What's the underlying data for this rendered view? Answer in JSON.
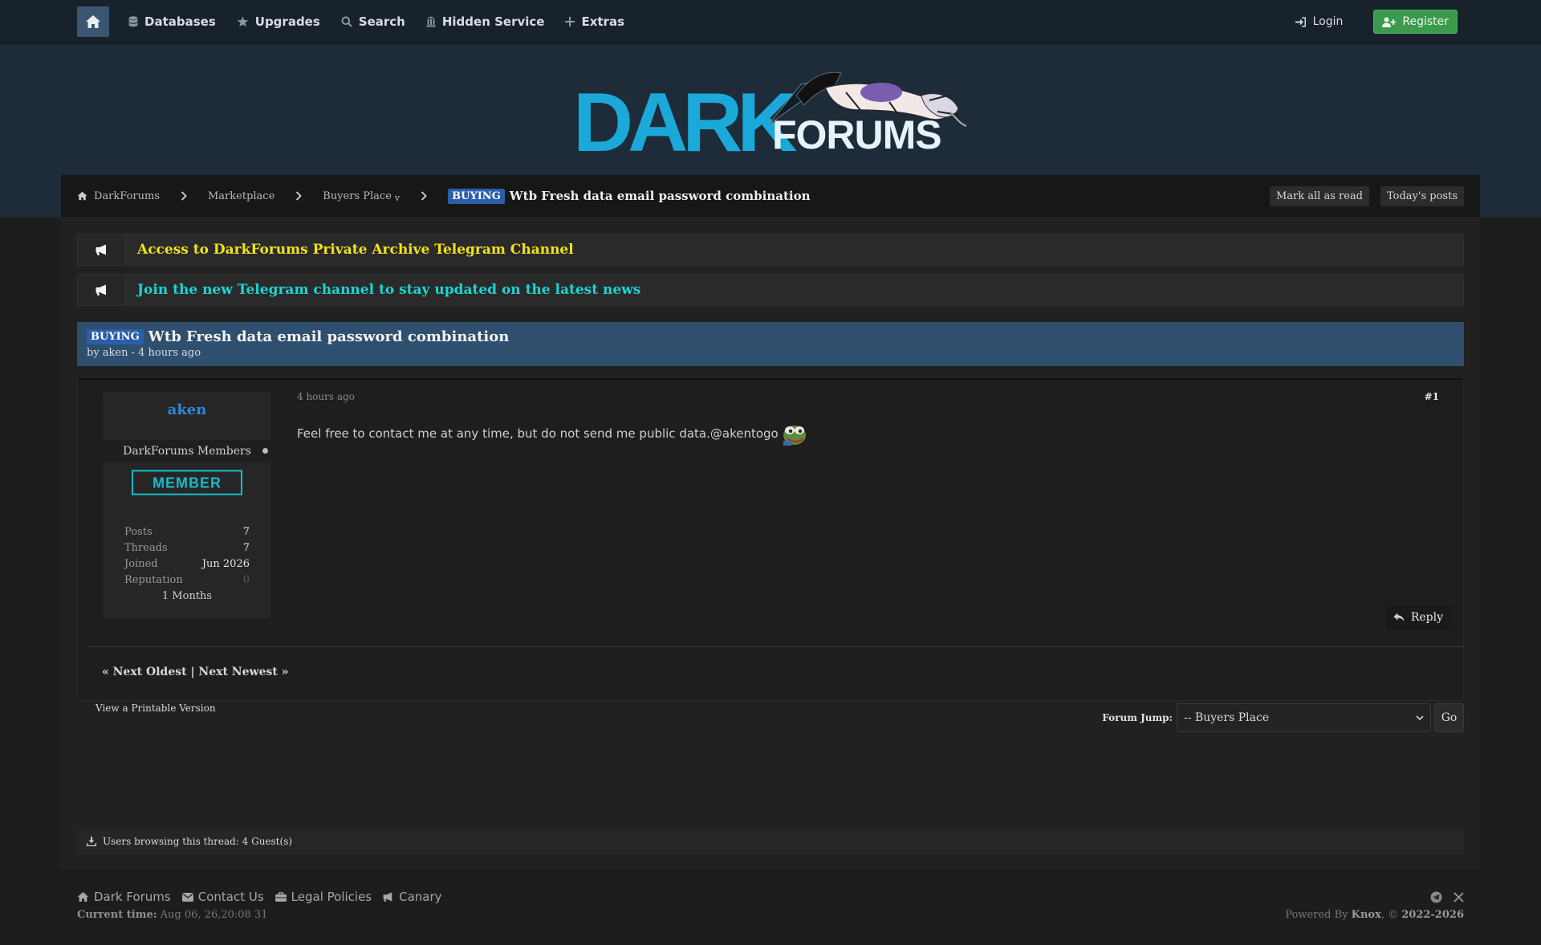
{
  "nav": {
    "items": [
      {
        "label": "Databases",
        "icon": "database-icon"
      },
      {
        "label": "Upgrades",
        "icon": "star-icon"
      },
      {
        "label": "Search",
        "icon": "search-icon"
      },
      {
        "label": "Hidden Service",
        "icon": "hidden-service-icon"
      },
      {
        "label": "Extras",
        "icon": "plus-icon"
      }
    ],
    "login": "Login",
    "register": "Register"
  },
  "logo": {
    "word1": "DARK",
    "word2": "FORUMS"
  },
  "breadcrumb": {
    "items": [
      "DarkForums",
      "Marketplace",
      "Buyers Place"
    ],
    "dropdown_mark": "v",
    "prefix": "BUYING",
    "current": "Wtb Fresh data email password combination",
    "mark_read": "Mark all as read",
    "todays_posts": "Today's posts"
  },
  "announcements": [
    {
      "text": "Access to DarkForums Private Archive Telegram Channel",
      "color": "#f2e318"
    },
    {
      "text": "Join the new Telegram channel to stay updated on the latest news",
      "color": "#1bd5d2"
    }
  ],
  "thread": {
    "prefix": "BUYING",
    "title": "Wtb Fresh data email password combination",
    "meta": "by aken - 4 hours ago"
  },
  "post": {
    "author": "aken",
    "group": "DarkForums Members",
    "badge": "MEMBER",
    "stats": [
      {
        "label": "Posts",
        "value": "7"
      },
      {
        "label": "Threads",
        "value": "7"
      },
      {
        "label": "Joined",
        "value": "Jun 2026"
      },
      {
        "label": "Reputation",
        "value": "0"
      }
    ],
    "tenure": "1 Months",
    "date": "4 hours ago",
    "number": "#1",
    "body": "Feel free to contact me at any time, but do not send me public data.@akentogo",
    "reply": "Reply"
  },
  "next_links": "« Next Oldest | Next Newest »",
  "printable": "View a Printable Version",
  "forum_jump": {
    "label": "Forum Jump:",
    "selected": "-- Buyers Place",
    "go": "Go"
  },
  "browsing": "Users browsing this thread: 4 Guest(s)",
  "footer": {
    "links": [
      "Dark Forums",
      "Contact Us",
      "Legal Policies",
      "Canary"
    ],
    "current_time_label": "Current time:",
    "current_time_value": "Aug 06, 26,20:08 31",
    "powered_prefix": "Powered By",
    "powered_name": "Knox",
    "powered_sep": ", ©",
    "powered_years": "2022-2026"
  },
  "colors": {
    "accent": "#2f88d8",
    "register": "#3c9a4c",
    "prefix": "#2b5ea8",
    "header": "#1e2b38"
  }
}
